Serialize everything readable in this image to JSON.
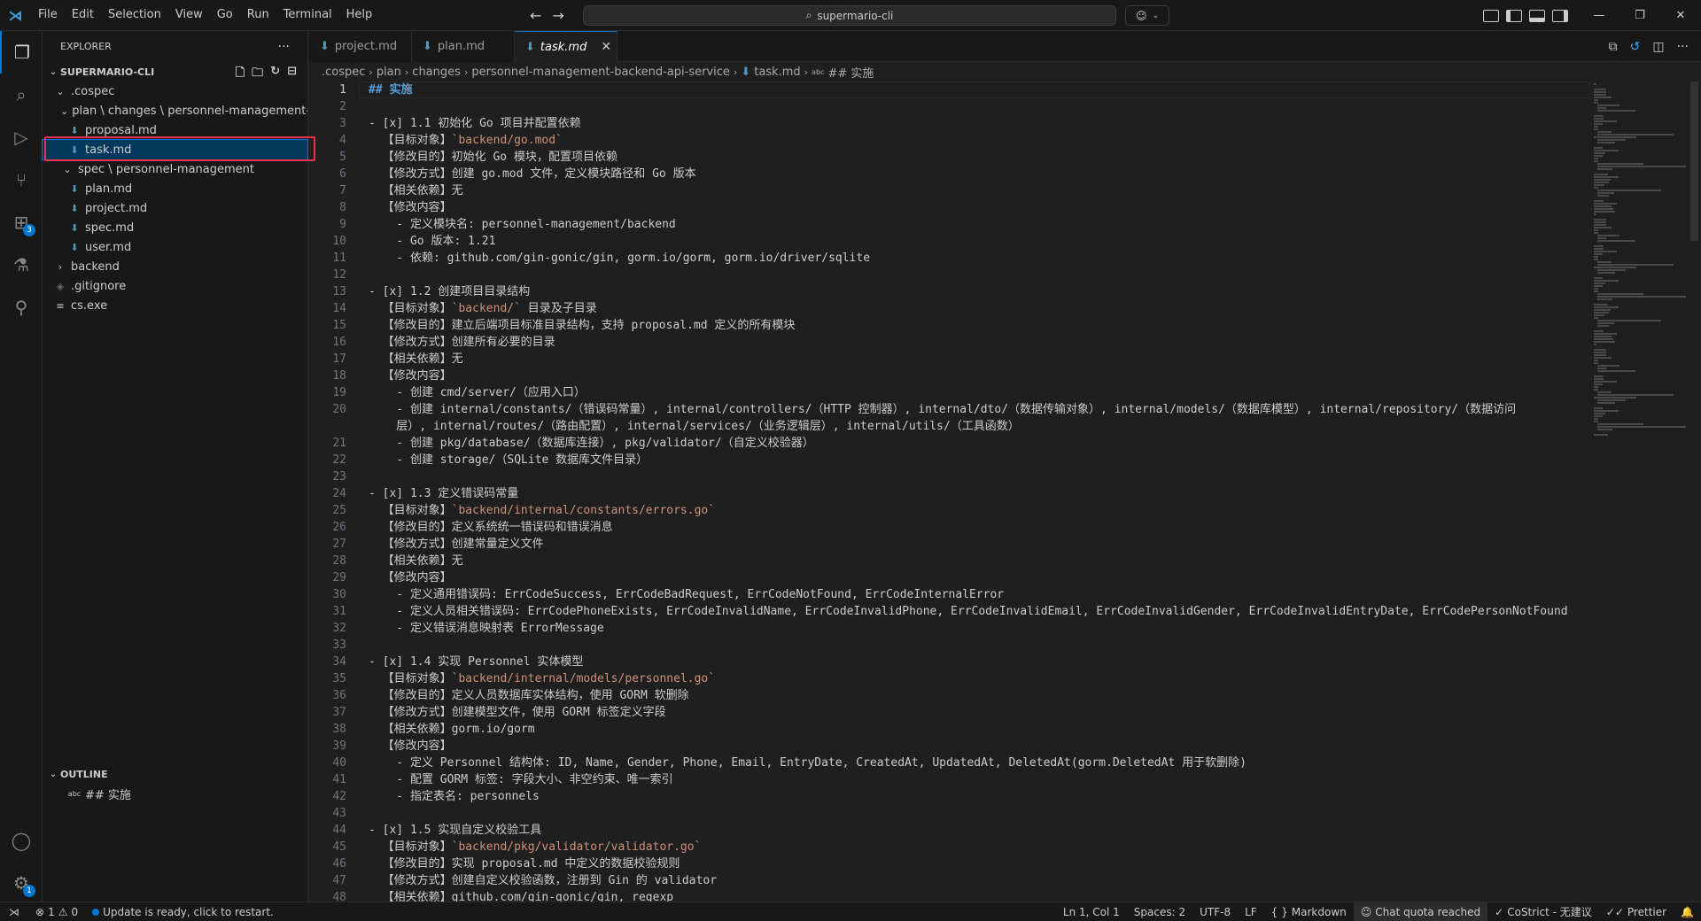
{
  "window": {
    "menu": [
      "File",
      "Edit",
      "Selection",
      "View",
      "Go",
      "Run",
      "Terminal",
      "Help"
    ],
    "search_text": "supermario-cli"
  },
  "sidebar": {
    "title": "EXPLORER",
    "root": "SUPERMARIO-CLI",
    "tree": [
      {
        "label": ".cospec",
        "depth": 1,
        "kind": "folder-open"
      },
      {
        "label": "plan \\ changes \\ personnel-management-ba...",
        "depth": 2,
        "kind": "folder-open"
      },
      {
        "label": "proposal.md",
        "depth": 3,
        "kind": "md"
      },
      {
        "label": "task.md",
        "depth": 3,
        "kind": "md",
        "selected": true
      },
      {
        "label": "spec \\ personnel-management",
        "depth": 2,
        "kind": "folder-open"
      },
      {
        "label": "plan.md",
        "depth": 3,
        "kind": "md"
      },
      {
        "label": "project.md",
        "depth": 3,
        "kind": "md"
      },
      {
        "label": "spec.md",
        "depth": 3,
        "kind": "md"
      },
      {
        "label": "user.md",
        "depth": 3,
        "kind": "md"
      },
      {
        "label": "backend",
        "depth": 1,
        "kind": "folder-closed"
      },
      {
        "label": ".gitignore",
        "depth": 1,
        "kind": "git"
      },
      {
        "label": "cs.exe",
        "depth": 1,
        "kind": "exe"
      }
    ],
    "outline_title": "OUTLINE",
    "outline_item": "## 实施"
  },
  "tabs": [
    {
      "label": "project.md",
      "active": false
    },
    {
      "label": "plan.md",
      "active": false
    },
    {
      "label": "task.md",
      "active": true
    }
  ],
  "breadcrumb": [
    ".cospec",
    "plan",
    "changes",
    "personnel-management-backend-api-service",
    "task.md",
    "## 实施"
  ],
  "editor_lines": [
    {
      "n": 1,
      "t": "## 实施",
      "k": "h"
    },
    {
      "n": 2,
      "t": ""
    },
    {
      "n": 3,
      "t": "- [x] 1.1 初始化 Go 项目并配置依赖",
      "k": "b"
    },
    {
      "n": 4,
      "t": "  【目标对象】",
      "c": "`backend/go.mod`"
    },
    {
      "n": 5,
      "t": "  【修改目的】初始化 Go 模块，配置项目依赖"
    },
    {
      "n": 6,
      "t": "  【修改方式】创建 go.mod 文件，定义模块路径和 Go 版本"
    },
    {
      "n": 7,
      "t": "  【相关依赖】无"
    },
    {
      "n": 8,
      "t": "  【修改内容】"
    },
    {
      "n": 9,
      "t": "    - 定义模块名: personnel-management/backend",
      "k": "sb"
    },
    {
      "n": 10,
      "t": "    - Go 版本: 1.21",
      "k": "sb"
    },
    {
      "n": 11,
      "t": "    - 依赖: github.com/gin-gonic/gin, gorm.io/gorm, gorm.io/driver/sqlite",
      "k": "sb"
    },
    {
      "n": 12,
      "t": ""
    },
    {
      "n": 13,
      "t": "- [x] 1.2 创建项目目录结构",
      "k": "b"
    },
    {
      "n": 14,
      "t": "  【目标对象】",
      "c": "`backend/`",
      "after": " 目录及子目录"
    },
    {
      "n": 15,
      "t": "  【修改目的】建立后端项目标准目录结构，支持 proposal.md 定义的所有模块"
    },
    {
      "n": 16,
      "t": "  【修改方式】创建所有必要的目录"
    },
    {
      "n": 17,
      "t": "  【相关依赖】无"
    },
    {
      "n": 18,
      "t": "  【修改内容】"
    },
    {
      "n": 19,
      "t": "    - 创建 cmd/server/（应用入口）",
      "k": "sb"
    },
    {
      "n": 20,
      "t": "    - 创建 internal/constants/（错误码常量）, internal/controllers/（HTTP 控制器）, internal/dto/（数据传输对象）, internal/models/（数据库模型）, internal/repository/（数据访问",
      "k": "sb"
    },
    {
      "n": null,
      "t": "    层）, internal/routes/（路由配置）, internal/services/（业务逻辑层）, internal/utils/（工具函数）"
    },
    {
      "n": 21,
      "t": "    - 创建 pkg/database/（数据库连接）, pkg/validator/（自定义校验器）",
      "k": "sb"
    },
    {
      "n": 22,
      "t": "    - 创建 storage/（SQLite 数据库文件目录）",
      "k": "sb"
    },
    {
      "n": 23,
      "t": ""
    },
    {
      "n": 24,
      "t": "- [x] 1.3 定义错误码常量",
      "k": "b"
    },
    {
      "n": 25,
      "t": "  【目标对象】",
      "c": "`backend/internal/constants/errors.go`"
    },
    {
      "n": 26,
      "t": "  【修改目的】定义系统统一错误码和错误消息"
    },
    {
      "n": 27,
      "t": "  【修改方式】创建常量定义文件"
    },
    {
      "n": 28,
      "t": "  【相关依赖】无"
    },
    {
      "n": 29,
      "t": "  【修改内容】"
    },
    {
      "n": 30,
      "t": "    - 定义通用错误码: ErrCodeSuccess, ErrCodeBadRequest, ErrCodeNotFound, ErrCodeInternalError",
      "k": "sb"
    },
    {
      "n": 31,
      "t": "    - 定义人员相关错误码: ErrCodePhoneExists, ErrCodeInvalidName, ErrCodeInvalidPhone, ErrCodeInvalidEmail, ErrCodeInvalidGender, ErrCodeInvalidEntryDate, ErrCodePersonNotFound",
      "k": "sb"
    },
    {
      "n": 32,
      "t": "    - 定义错误消息映射表 ErrorMessage",
      "k": "sb"
    },
    {
      "n": 33,
      "t": ""
    },
    {
      "n": 34,
      "t": "- [x] 1.4 实现 Personnel 实体模型",
      "k": "b"
    },
    {
      "n": 35,
      "t": "  【目标对象】",
      "c": "`backend/internal/models/personnel.go`"
    },
    {
      "n": 36,
      "t": "  【修改目的】定义人员数据库实体结构，使用 GORM 软删除"
    },
    {
      "n": 37,
      "t": "  【修改方式】创建模型文件，使用 GORM 标签定义字段"
    },
    {
      "n": 38,
      "t": "  【相关依赖】gorm.io/gorm"
    },
    {
      "n": 39,
      "t": "  【修改内容】"
    },
    {
      "n": 40,
      "t": "    - 定义 Personnel 结构体: ID, Name, Gender, Phone, Email, EntryDate, CreatedAt, UpdatedAt, DeletedAt(gorm.DeletedAt 用于软删除)",
      "k": "sb"
    },
    {
      "n": 41,
      "t": "    - 配置 GORM 标签: 字段大小、非空约束、唯一索引",
      "k": "sb"
    },
    {
      "n": 42,
      "t": "    - 指定表名: personnels",
      "k": "sb"
    },
    {
      "n": 43,
      "t": ""
    },
    {
      "n": 44,
      "t": "- [x] 1.5 实现自定义校验工具",
      "k": "b"
    },
    {
      "n": 45,
      "t": "  【目标对象】",
      "c": "`backend/pkg/validator/validator.go`"
    },
    {
      "n": 46,
      "t": "  【修改目的】实现 proposal.md 中定义的数据校验规则"
    },
    {
      "n": 47,
      "t": "  【修改方式】创建自定义校验函数，注册到 Gin 的 validator"
    },
    {
      "n": 48,
      "t": "  【相关依赖】github.com/gin-gonic/gin, regexp"
    }
  ],
  "status": {
    "errors": "1",
    "warnings": "0",
    "update": "Update is ready, click to restart.",
    "position": "Ln 1, Col 1",
    "spaces": "Spaces: 2",
    "encoding": "UTF-8",
    "eol": "LF",
    "language": "Markdown",
    "chat": "Chat quota reached",
    "costrict": "CoStrict - 无建议",
    "prettier": "Prettier"
  },
  "colors": {
    "accent": "#0078d4",
    "highlight_box": "#e5334b",
    "heading": "#569cd6",
    "inline_code": "#ce9178"
  }
}
